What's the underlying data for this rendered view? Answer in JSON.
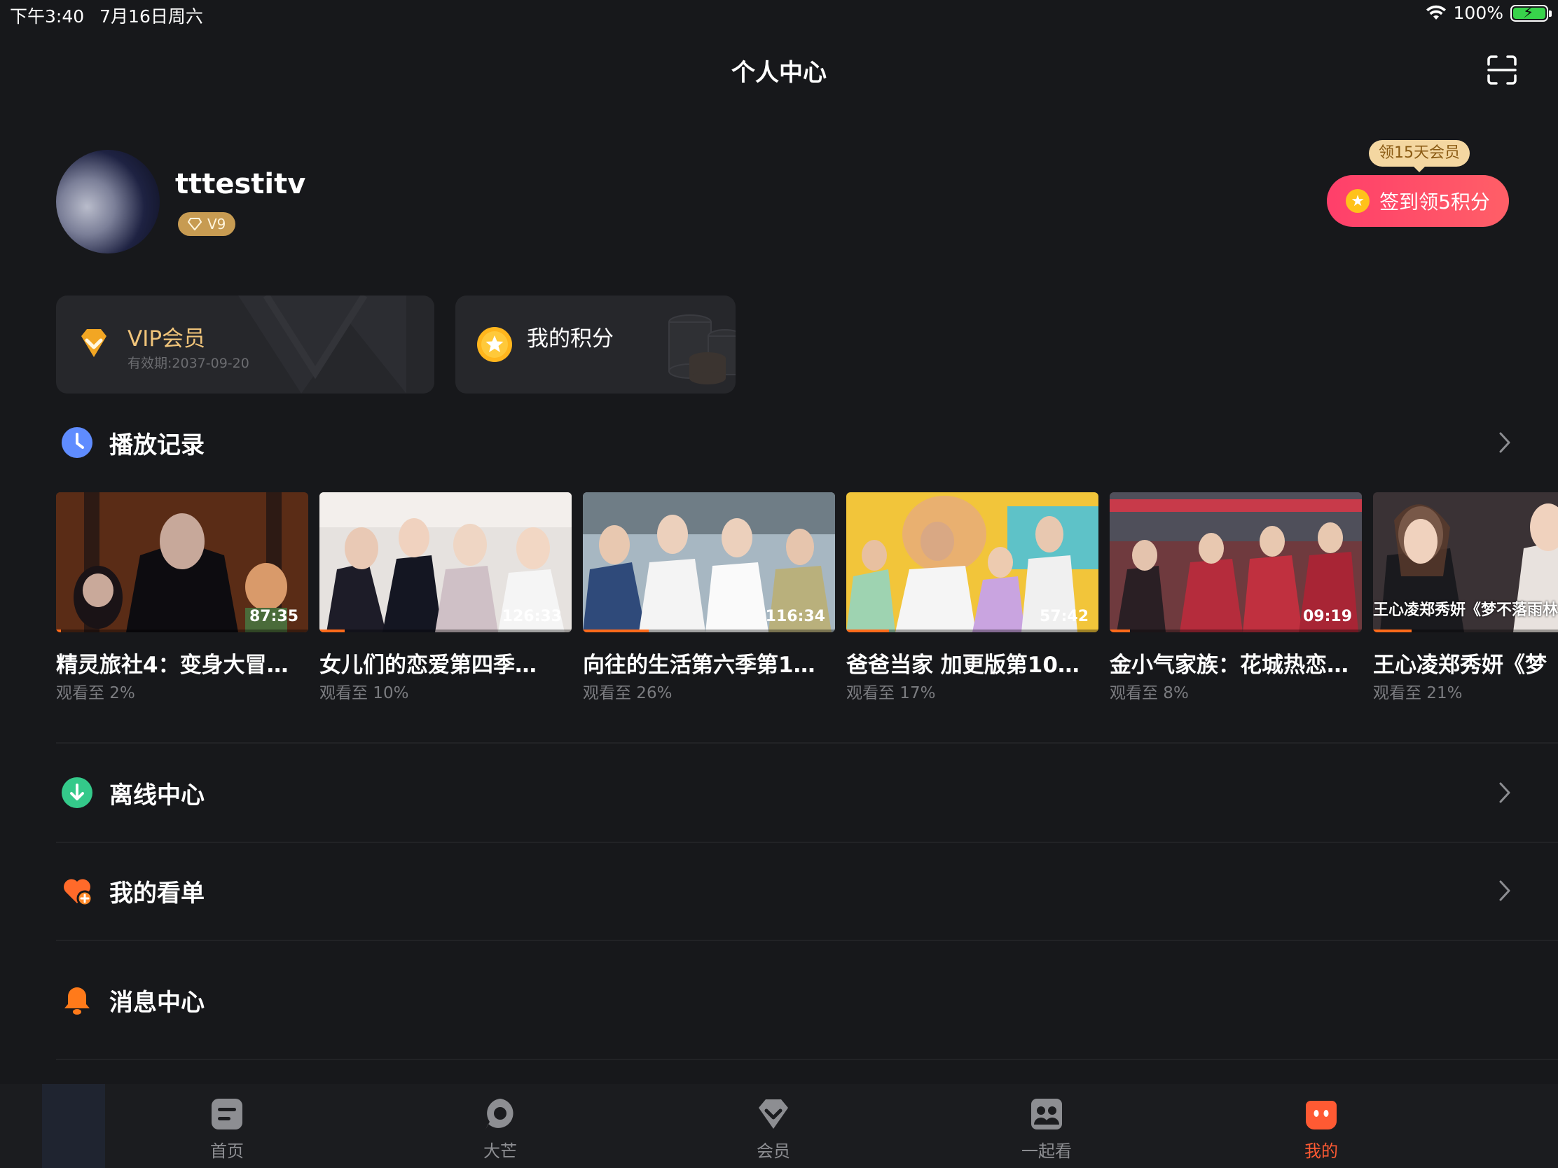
{
  "status_bar": {
    "time": "下午3:40",
    "date": "7月16日周六",
    "battery": "100%"
  },
  "page_title": "个人中心",
  "profile": {
    "username": "tttestitv",
    "level": "V9"
  },
  "signin": {
    "tooltip": "领15天会员",
    "button_label": "签到领5积分"
  },
  "vip_card": {
    "title": "VIP会员",
    "expiry": "有效期:2037-09-20"
  },
  "points_card": {
    "title": "我的积分"
  },
  "history": {
    "title": "播放记录",
    "items": [
      {
        "title": "精灵旅社4：变身大冒…",
        "progress_label": "观看至 2%",
        "duration": "87:35",
        "progress": 0.02
      },
      {
        "title": "女儿们的恋爱第四季…",
        "progress_label": "观看至 10%",
        "duration": "126:33",
        "progress": 0.1
      },
      {
        "title": "向往的生活第六季第1…",
        "progress_label": "观看至 26%",
        "duration": "116:34",
        "progress": 0.26
      },
      {
        "title": "爸爸当家 加更版第10…",
        "progress_label": "观看至 17%",
        "duration": "57:42",
        "progress": 0.17
      },
      {
        "title": "金小气家族：花城热恋…",
        "progress_label": "观看至 8%",
        "duration": "09:19",
        "progress": 0.08
      },
      {
        "title": "王心凌郑秀妍《梦",
        "progress_label": "观看至 21%",
        "duration": "",
        "overlay_text": "王心凌郑秀妍《梦不落雨林",
        "progress": 0.21
      }
    ]
  },
  "menu": {
    "offline": "离线中心",
    "watchlist": "我的看单",
    "messages": "消息中心"
  },
  "tabs": [
    {
      "label": "首页",
      "icon": "home-icon"
    },
    {
      "label": "大芒",
      "icon": "damang-icon"
    },
    {
      "label": "会员",
      "icon": "vip-icon"
    },
    {
      "label": "一起看",
      "icon": "watch-together-icon"
    },
    {
      "label": "我的",
      "icon": "mine-icon",
      "active": true
    }
  ],
  "colors": {
    "accent": "#ff5a33",
    "progress": "#ff6a1a",
    "vip_gold": "#f0c47a",
    "signin": "#ff4a69"
  }
}
